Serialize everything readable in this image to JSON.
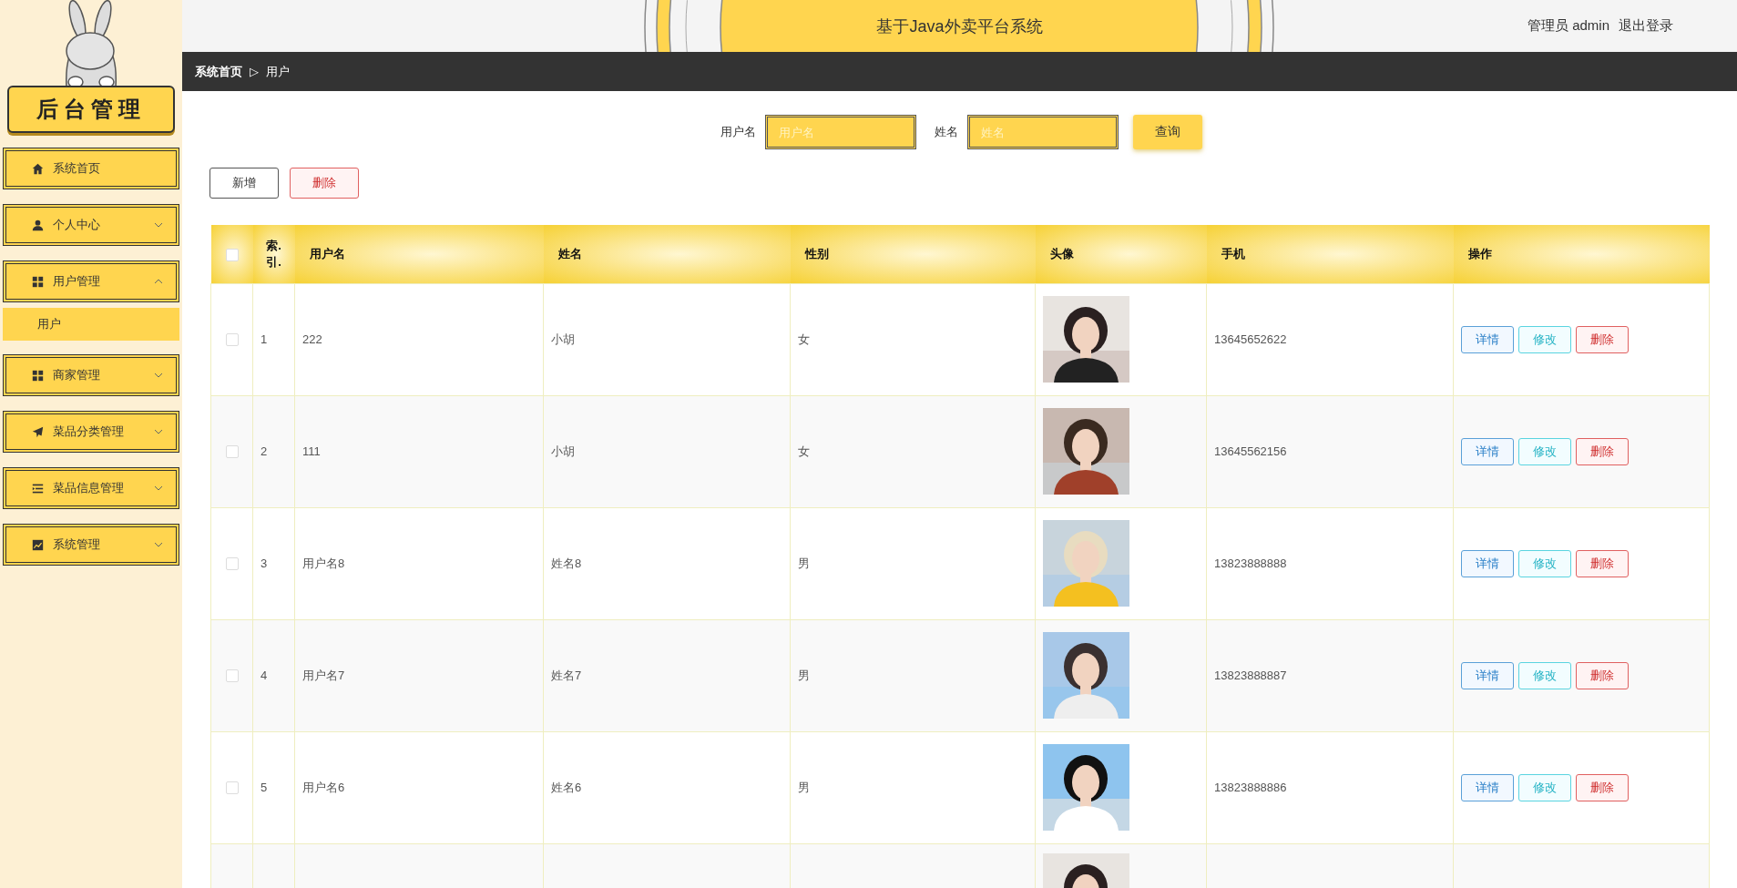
{
  "logo": {
    "text": "后台管理"
  },
  "menu": [
    {
      "label": "系统首页",
      "kind": "link"
    },
    {
      "label": "个人中心",
      "kind": "group",
      "expanded": false
    },
    {
      "label": "用户管理",
      "kind": "group",
      "expanded": true,
      "children": [
        {
          "label": "用户",
          "selected": true
        }
      ]
    },
    {
      "label": "商家管理",
      "kind": "group",
      "expanded": false
    },
    {
      "label": "菜品分类管理",
      "kind": "group",
      "expanded": false
    },
    {
      "label": "菜品信息管理",
      "kind": "group",
      "expanded": false
    },
    {
      "label": "系统管理",
      "kind": "group",
      "expanded": false
    }
  ],
  "header": {
    "title": "基于Java外卖平台系统",
    "user": "管理员 admin",
    "logout": "退出登录"
  },
  "breadcrumb": {
    "items": [
      "系统首页",
      "用户"
    ],
    "separator": "▷"
  },
  "search": {
    "fields": [
      {
        "label": "用户名",
        "placeholder": "用户名"
      },
      {
        "label": "姓名",
        "placeholder": "姓名"
      }
    ],
    "button": "查询"
  },
  "toolbar": [
    {
      "label": "新增",
      "kind": "add"
    },
    {
      "label": "删除",
      "kind": "delete"
    }
  ],
  "table": {
    "select_all": {
      "checked": false
    },
    "columns": [
      "索.引.",
      "用户名",
      "姓名",
      "性别",
      "头像",
      "手机",
      "操作"
    ],
    "rows": [
      {
        "checked": false,
        "index": "1",
        "username": "222",
        "name": "小胡",
        "gender": "女",
        "avatar": {
          "kind": "picture"
        },
        "phone": "13645652622",
        "actions": [
          {
            "label": "详情",
            "kind": "detail"
          },
          {
            "label": "修改",
            "kind": "edit"
          },
          {
            "label": "删除",
            "kind": "delete"
          }
        ]
      },
      {
        "checked": false,
        "index": "2",
        "username": "111",
        "name": "小胡",
        "gender": "女",
        "avatar": {
          "kind": "picture"
        },
        "phone": "13645562156",
        "actions": [
          {
            "label": "详情",
            "kind": "detail"
          },
          {
            "label": "修改",
            "kind": "edit"
          },
          {
            "label": "删除",
            "kind": "delete"
          }
        ]
      },
      {
        "checked": false,
        "index": "3",
        "username": "用户名8",
        "name": "姓名8",
        "gender": "男",
        "avatar": {
          "kind": "picture"
        },
        "phone": "13823888888",
        "actions": [
          {
            "label": "详情",
            "kind": "detail"
          },
          {
            "label": "修改",
            "kind": "edit"
          },
          {
            "label": "删除",
            "kind": "delete"
          }
        ]
      },
      {
        "checked": false,
        "index": "4",
        "username": "用户名7",
        "name": "姓名7",
        "gender": "男",
        "avatar": {
          "kind": "picture"
        },
        "phone": "13823888887",
        "actions": [
          {
            "label": "详情",
            "kind": "detail"
          },
          {
            "label": "修改",
            "kind": "edit"
          },
          {
            "label": "删除",
            "kind": "delete"
          }
        ]
      },
      {
        "checked": false,
        "index": "5",
        "username": "用户名6",
        "name": "姓名6",
        "gender": "男",
        "avatar": {
          "kind": "picture"
        },
        "phone": "13823888886",
        "actions": [
          {
            "label": "详情",
            "kind": "detail"
          },
          {
            "label": "修改",
            "kind": "edit"
          },
          {
            "label": "删除",
            "kind": "delete"
          }
        ]
      },
      {
        "avatar": {
          "kind": "picture"
        }
      }
    ]
  }
}
